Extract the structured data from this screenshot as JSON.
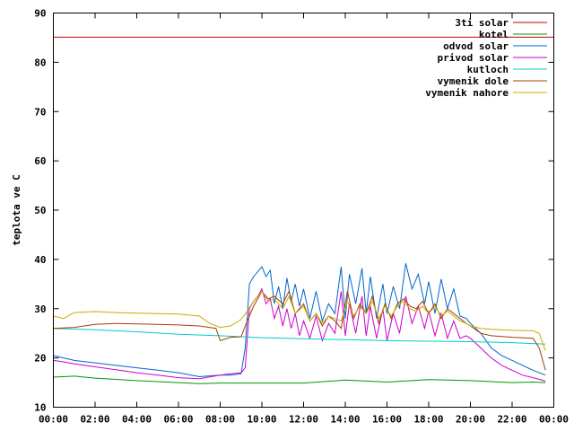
{
  "chart_data": {
    "type": "line",
    "title": "",
    "xlabel": "",
    "ylabel": "teplota ve C",
    "ylim": [
      10,
      90
    ],
    "xlim": [
      0,
      24
    ],
    "yticks": [
      10,
      20,
      30,
      40,
      50,
      60,
      70,
      80,
      90
    ],
    "xticks": [
      0,
      2,
      4,
      6,
      8,
      10,
      12,
      14,
      16,
      18,
      20,
      22,
      24
    ],
    "xtick_labels": [
      "00:00",
      "02:00",
      "04:00",
      "06:00",
      "08:00",
      "10:00",
      "12:00",
      "14:00",
      "16:00",
      "18:00",
      "20:00",
      "22:00",
      "00:00"
    ],
    "grid": false,
    "legend_position": "top-right",
    "series": [
      {
        "name": "3ti solar",
        "color": "#c00000",
        "x": [
          0,
          24
        ],
        "y": [
          85.1,
          85.1
        ]
      },
      {
        "name": "kotel",
        "color": "#009900",
        "x": [
          0,
          1,
          2,
          4,
          6,
          7,
          8,
          10,
          12,
          14,
          16,
          18,
          20,
          22,
          23,
          23.6
        ],
        "y": [
          16.1,
          16.3,
          15.9,
          15.4,
          15.0,
          14.8,
          14.9,
          14.9,
          14.9,
          15.5,
          15.1,
          15.6,
          15.4,
          15.0,
          15.1,
          15.0
        ]
      },
      {
        "name": "odvod solar",
        "color": "#0066cc",
        "x": [
          0,
          0.5,
          1,
          2,
          3,
          4,
          5,
          6,
          7,
          8,
          8.5,
          9,
          9.2,
          9.4,
          9.6,
          9.8,
          10,
          10.2,
          10.4,
          10.6,
          10.8,
          11,
          11.2,
          11.4,
          11.6,
          11.8,
          12,
          12.3,
          12.6,
          12.9,
          13.2,
          13.5,
          13.8,
          14,
          14.2,
          14.5,
          14.8,
          15,
          15.2,
          15.5,
          15.8,
          16,
          16.3,
          16.6,
          16.9,
          17.2,
          17.5,
          17.8,
          18,
          18.3,
          18.6,
          18.9,
          19.2,
          19.5,
          19.8,
          20,
          20.5,
          21,
          21.5,
          22,
          22.5,
          23,
          23.6
        ],
        "y": [
          20.5,
          20.0,
          19.5,
          19.0,
          18.5,
          18.0,
          17.5,
          17.0,
          16.2,
          16.5,
          16.5,
          16.8,
          22,
          35,
          36.5,
          37.5,
          38.5,
          36.5,
          37.8,
          31,
          34.5,
          30,
          36.2,
          31.5,
          35,
          30.5,
          34,
          28,
          33.5,
          27.5,
          31,
          29,
          38.5,
          28,
          37,
          31,
          38.2,
          29,
          36.5,
          28,
          35,
          29,
          34.5,
          30,
          39.2,
          34,
          37,
          31,
          35.5,
          29,
          36,
          30,
          34,
          28.5,
          28,
          27,
          25,
          22,
          20.5,
          19.5,
          18.5,
          17.5,
          16.5
        ]
      },
      {
        "name": "privod solar",
        "color": "#cc00cc",
        "x": [
          0,
          0.5,
          1,
          2,
          3,
          4,
          5,
          6,
          7,
          8,
          8.5,
          9,
          9.2,
          9.4,
          9.6,
          9.8,
          10,
          10.2,
          10.4,
          10.6,
          10.8,
          11,
          11.2,
          11.4,
          11.6,
          11.8,
          12,
          12.3,
          12.6,
          12.9,
          13.2,
          13.5,
          13.8,
          14,
          14.2,
          14.5,
          14.8,
          15,
          15.2,
          15.5,
          15.8,
          16,
          16.3,
          16.6,
          16.9,
          17.2,
          17.5,
          17.8,
          18,
          18.3,
          18.6,
          18.9,
          19.2,
          19.5,
          19.8,
          20,
          20.5,
          21,
          21.5,
          22,
          22.5,
          23,
          23.6
        ],
        "y": [
          19.5,
          19.2,
          18.8,
          18.2,
          17.6,
          17.0,
          16.5,
          16.0,
          15.8,
          16.5,
          16.8,
          17,
          18,
          30,
          31.5,
          32.5,
          34,
          31,
          32,
          28,
          30.5,
          26.5,
          30,
          26,
          29,
          24.5,
          27.5,
          24,
          28.5,
          23.5,
          27,
          25,
          33.5,
          24.5,
          31,
          25,
          32.5,
          24.5,
          30.5,
          24,
          30,
          23.5,
          29,
          25,
          32.5,
          27,
          30.5,
          26,
          29.5,
          24.5,
          29,
          24,
          27.5,
          24,
          24.5,
          24,
          22,
          20,
          18.5,
          17.5,
          16.5,
          16,
          15.3
        ]
      },
      {
        "name": "kutloch",
        "color": "#00cccc",
        "x": [
          0,
          2,
          4,
          6,
          8,
          9,
          10,
          12,
          14,
          16,
          18,
          20,
          22,
          23.6
        ],
        "y": [
          26.0,
          25.7,
          25.3,
          24.8,
          24.5,
          24.3,
          24.1,
          23.9,
          23.7,
          23.5,
          23.4,
          23.3,
          23.1,
          22.8
        ]
      },
      {
        "name": "vymenik dole",
        "color": "#a04000",
        "x": [
          0,
          1,
          2,
          3,
          4,
          5,
          6,
          7,
          7.8,
          8,
          8.5,
          9,
          9.3,
          9.6,
          10,
          10.3,
          10.6,
          11,
          11.3,
          11.6,
          12,
          12.3,
          12.6,
          12.9,
          13.2,
          13.5,
          13.8,
          14.1,
          14.4,
          14.7,
          15,
          15.3,
          15.6,
          15.9,
          16.2,
          16.5,
          16.8,
          17.1,
          17.4,
          17.7,
          18,
          18.3,
          18.6,
          18.9,
          19.2,
          19.5,
          19.8,
          20,
          20.5,
          21,
          22,
          23,
          23.3,
          23.6
        ],
        "y": [
          26.0,
          26.2,
          26.8,
          27.0,
          26.9,
          26.8,
          26.7,
          26.5,
          26.0,
          23.5,
          24.2,
          24.3,
          27.5,
          30.5,
          33.5,
          32,
          32.5,
          31,
          33.5,
          29,
          31,
          27.5,
          29,
          26.5,
          28.5,
          27.5,
          26,
          33.5,
          28,
          31,
          29,
          32.5,
          27,
          31,
          28,
          31,
          32,
          30.5,
          30,
          31.5,
          29,
          31,
          28,
          30,
          29,
          28,
          27,
          26.5,
          25,
          24.5,
          24.2,
          24.0,
          22,
          17.5
        ]
      },
      {
        "name": "vymenik nahore",
        "color": "#ccaa00",
        "x": [
          0,
          0.5,
          1,
          2,
          3,
          4,
          5,
          6,
          7,
          7.5,
          8,
          8.5,
          9,
          9.3,
          9.6,
          10,
          10.3,
          10.6,
          11,
          11.3,
          11.6,
          12,
          12.3,
          12.6,
          12.9,
          13.2,
          13.5,
          13.8,
          14.1,
          14.4,
          14.7,
          15,
          15.3,
          15.6,
          15.9,
          16.2,
          16.5,
          16.8,
          17.1,
          17.4,
          17.7,
          18,
          18.3,
          18.6,
          18.9,
          19.2,
          19.5,
          19.8,
          20,
          20.5,
          21,
          22,
          23,
          23.3,
          23.6
        ],
        "y": [
          28.5,
          28.0,
          29.2,
          29.4,
          29.2,
          29.1,
          29.0,
          28.9,
          28.5,
          27.0,
          26.2,
          26.5,
          27.8,
          29.5,
          31.5,
          33.5,
          31.5,
          32,
          30,
          32.5,
          29,
          30.5,
          27.5,
          29,
          27,
          28.5,
          28,
          27.5,
          31.5,
          28.5,
          30.5,
          29,
          31.5,
          28,
          30.5,
          28.5,
          30.5,
          31.5,
          30,
          29.5,
          30.5,
          29,
          30.5,
          28.5,
          29.5,
          28.5,
          27.5,
          27,
          26.5,
          26.0,
          25.8,
          25.6,
          25.5,
          25.0,
          21.5
        ]
      }
    ]
  }
}
